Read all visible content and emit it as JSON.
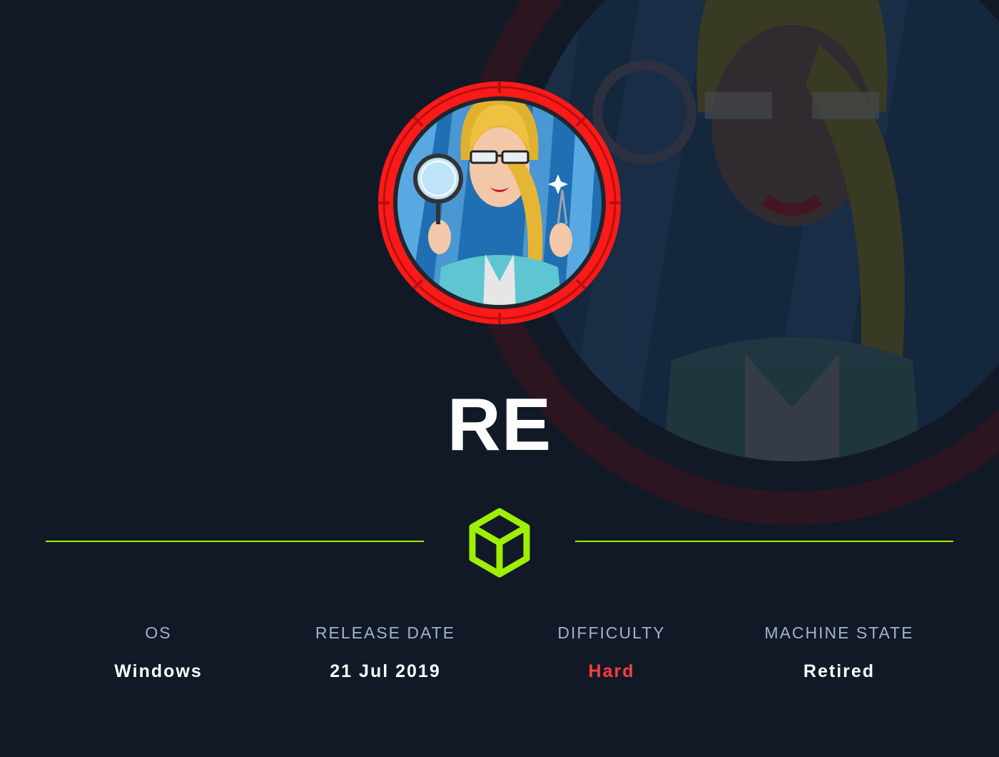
{
  "machine": {
    "name": "RE"
  },
  "stats": [
    {
      "label": "OS",
      "value": "Windows"
    },
    {
      "label": "RELEASE DATE",
      "value": "21 Jul 2019"
    },
    {
      "label": "DIFFICULTY",
      "value": "Hard"
    },
    {
      "label": "MACHINE STATE",
      "value": "Retired"
    }
  ],
  "colors": {
    "background": "#111927",
    "accent": "#9fef00",
    "difficulty_hard": "#ff3e3e",
    "label": "#a4b1cd",
    "avatar_ring": "#ff1a1a"
  },
  "icons": {
    "divider": "cube-icon",
    "avatar": "machine-avatar"
  }
}
